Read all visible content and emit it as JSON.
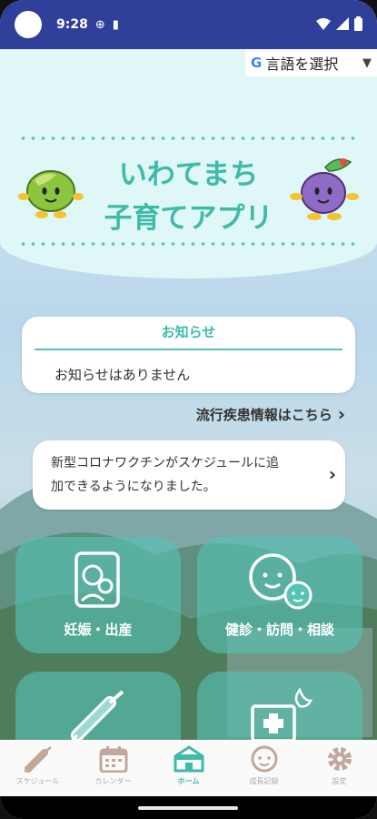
{
  "status_bar": {
    "time": "9:28",
    "icons": [
      "circle",
      "globe-icon",
      "sim-icon",
      "wifi-icon",
      "signal-icon",
      "battery-icon"
    ]
  },
  "language_selector": {
    "icon": "google-g-icon",
    "g": "G",
    "label": "言語を選択",
    "arrow": "▼"
  },
  "header": {
    "title_line1": "いわてまち",
    "title_line2": "子育てアプリ"
  },
  "notice": {
    "title": "お知らせ",
    "body": "お知らせはありません"
  },
  "epidemic_link": {
    "label": "流行疾患情報はこちら",
    "arrow": "›"
  },
  "news": {
    "text_line1": "新型コロナワクチンがスケジュールに追",
    "text_line2": "加できるようになりました。",
    "arrow": "›"
  },
  "tiles": [
    {
      "label": "妊娠・出産",
      "icon": "mother-child-book-icon"
    },
    {
      "label": "健診・訪問・相談",
      "icon": "parent-child-faces-icon"
    },
    {
      "label": "",
      "icon": "syringe-icon"
    },
    {
      "label": "",
      "icon": "hospital-night-icon"
    }
  ],
  "bottom_nav": [
    {
      "label": "スケジュール",
      "icon": "syringe-icon"
    },
    {
      "label": "カレンダー",
      "icon": "calendar-icon"
    },
    {
      "label": "ホーム",
      "icon": "home-icon",
      "active": true
    },
    {
      "label": "成長記録",
      "icon": "baby-face-icon"
    },
    {
      "label": "設定",
      "icon": "gear-icon"
    }
  ],
  "colors": {
    "accent": "#56c3b4",
    "accent_text": "#3fbaa9",
    "status_bar": "#2f3f9a",
    "header_bg": "#dff7f7"
  }
}
